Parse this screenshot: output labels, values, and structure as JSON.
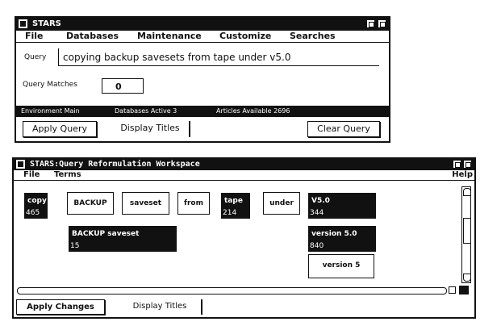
{
  "window1": {
    "title": "STARS",
    "menu": [
      "File",
      "Databases",
      "Maintenance",
      "Customize",
      "Searches"
    ],
    "query_label": "Query",
    "query_value": "copying backup savesets from tape under v5.0",
    "matches_label": "Query Matches",
    "matches_value": "0",
    "status": {
      "environment": "Environment Main",
      "databases": "Databases Active 3",
      "articles": "Articles Available 2696"
    },
    "buttons": {
      "apply": "Apply Query",
      "display": "Display Titles",
      "clear": "Clear Query"
    }
  },
  "window2": {
    "title": "STARS:Query Reformulation Workspace",
    "menu": [
      "File",
      "Terms"
    ],
    "help": "Help",
    "terms": [
      {
        "label": "copy",
        "count": "465",
        "style": "black"
      },
      {
        "label": "BACKUP",
        "count": "",
        "style": "white"
      },
      {
        "label": "saveset",
        "count": "",
        "style": "white"
      },
      {
        "label": "from",
        "count": "",
        "style": "white"
      },
      {
        "label": "tape",
        "count": "214",
        "style": "black"
      },
      {
        "label": "under",
        "count": "",
        "style": "white"
      },
      {
        "label": "V5.0",
        "count": "344",
        "style": "black"
      },
      {
        "label": "BACKUP saveset",
        "count": "15",
        "style": "black"
      },
      {
        "label": "version 5.0",
        "count": "840",
        "style": "black"
      },
      {
        "label": "version 5",
        "count": "",
        "style": "white"
      }
    ],
    "buttons": {
      "apply": "Apply Changes",
      "display": "Display Titles"
    }
  }
}
